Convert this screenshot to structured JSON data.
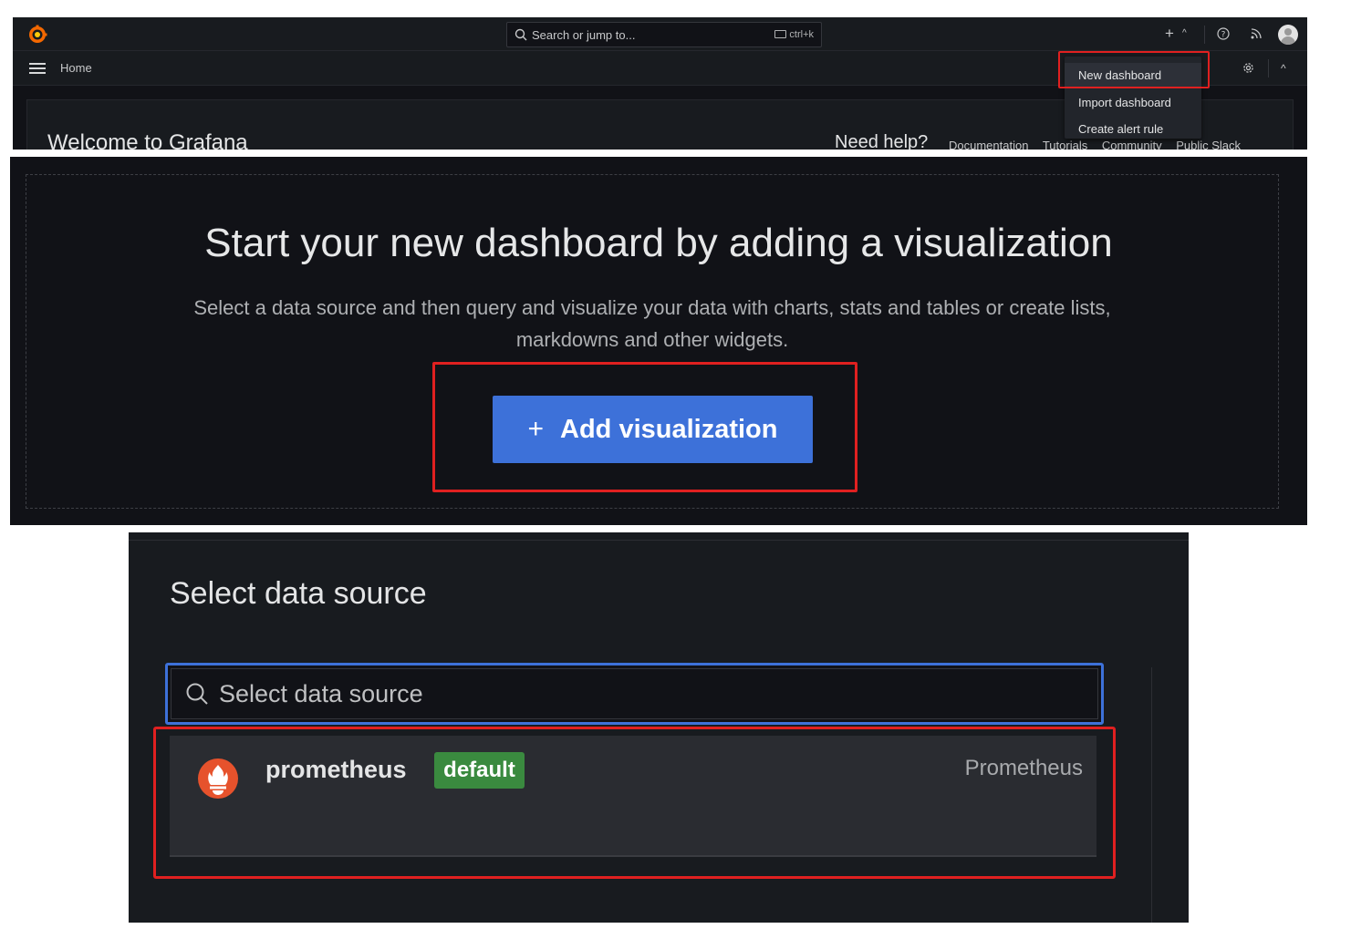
{
  "topbar": {
    "search_placeholder": "Search or jump to...",
    "search_shortcut": "ctrl+k"
  },
  "breadcrumb": {
    "home": "Home"
  },
  "new_menu": {
    "items": [
      "New dashboard",
      "Import dashboard",
      "Create alert rule"
    ],
    "highlighted": "New dashboard"
  },
  "home": {
    "welcome": "Welcome to Grafana",
    "need_help": "Need help?",
    "help_links": [
      "Documentation",
      "Tutorials",
      "Community",
      "Public Slack"
    ]
  },
  "empty_dashboard": {
    "heading": "Start your new dashboard by adding a visualization",
    "description_line1": "Select a data source and then query and visualize your data with charts, stats and tables or create lists,",
    "description_line2": "markdowns and other widgets.",
    "button_label": "Add visualization",
    "button_icon": "+"
  },
  "datasource_picker": {
    "title": "Select data source",
    "search_placeholder": "Select data source",
    "items": [
      {
        "name": "prometheus",
        "badge": "default",
        "type": "Prometheus"
      }
    ]
  },
  "colors": {
    "background": "#111217",
    "panel": "#181b1f",
    "primary_button": "#3d71d9",
    "badge_green": "#3a8a3f",
    "highlight_red": "#e02020",
    "grafana_orange": "#f46800"
  }
}
